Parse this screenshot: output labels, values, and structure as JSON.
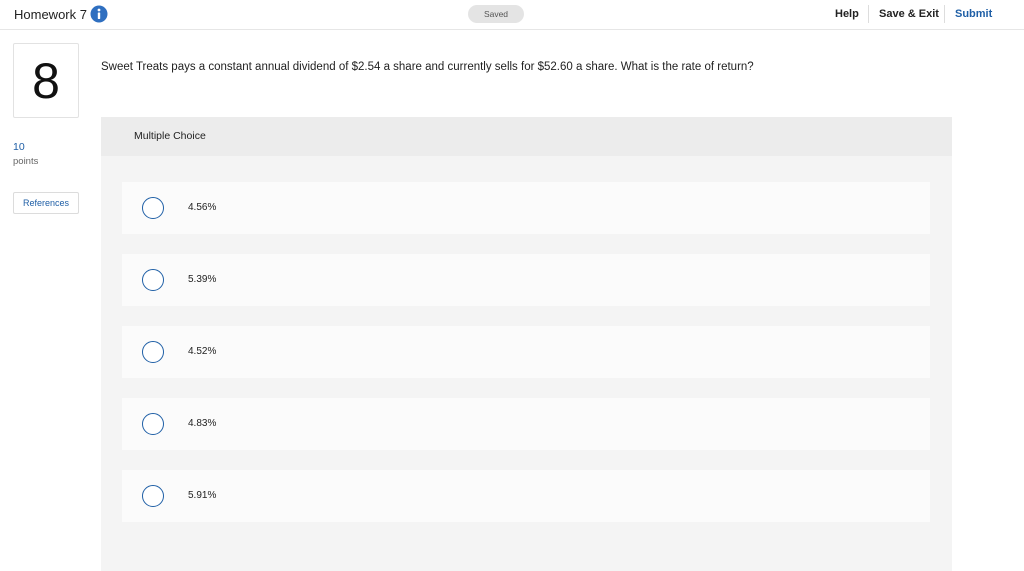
{
  "header": {
    "title": "Homework 7",
    "info_icon": "info-icon",
    "saved_label": "Saved",
    "help_label": "Help",
    "save_exit_label": "Save & Exit",
    "submit_label": "Submit",
    "accent_color": "#1f5fa6"
  },
  "sidebar": {
    "question_number": "8",
    "points_value": "10",
    "points_label": "points",
    "references_label": "References"
  },
  "question": {
    "text": "Sweet Treats pays a constant annual dividend of $2.54 a share and currently sells for $52.60 a share. What is the rate of return?"
  },
  "answer_panel": {
    "type_label": "Multiple Choice",
    "options": [
      {
        "label": "4.56%"
      },
      {
        "label": "5.39%"
      },
      {
        "label": "4.52%"
      },
      {
        "label": "4.83%"
      },
      {
        "label": "5.91%"
      }
    ]
  }
}
